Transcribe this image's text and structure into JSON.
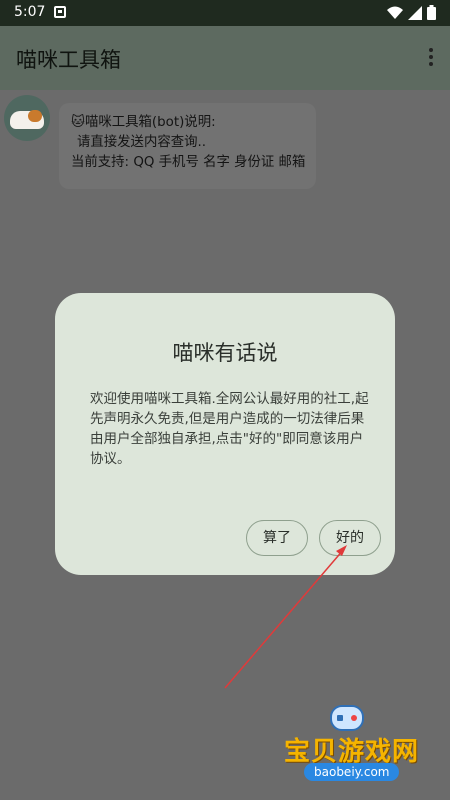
{
  "status_bar": {
    "time": "5:07"
  },
  "app_bar": {
    "title": "喵咪工具箱"
  },
  "message": {
    "lines": [
      "🐱喵咪工具箱(bot)说明:",
      "请直接发送内容查询..",
      "当前支持: QQ 手机号 名字 身份证 邮箱"
    ]
  },
  "dialog": {
    "title": "喵咪有话说",
    "body": "欢迎使用喵咪工具箱.全网公认最好用的社工,起先声明永久免责,但是用户造成的一切法律后果由用户全部独自承担,点击\"好的\"即同意该用户协议。",
    "cancel_label": "算了",
    "ok_label": "好的"
  },
  "watermark": {
    "brand": "宝贝游戏网",
    "url": "baobeiy.com"
  },
  "colors": {
    "status_bar_bg": "#1f2a1f",
    "app_bar_bg": "#5d6a60",
    "dialog_bg": "#dde6da",
    "arrow": "#e03a3a"
  }
}
